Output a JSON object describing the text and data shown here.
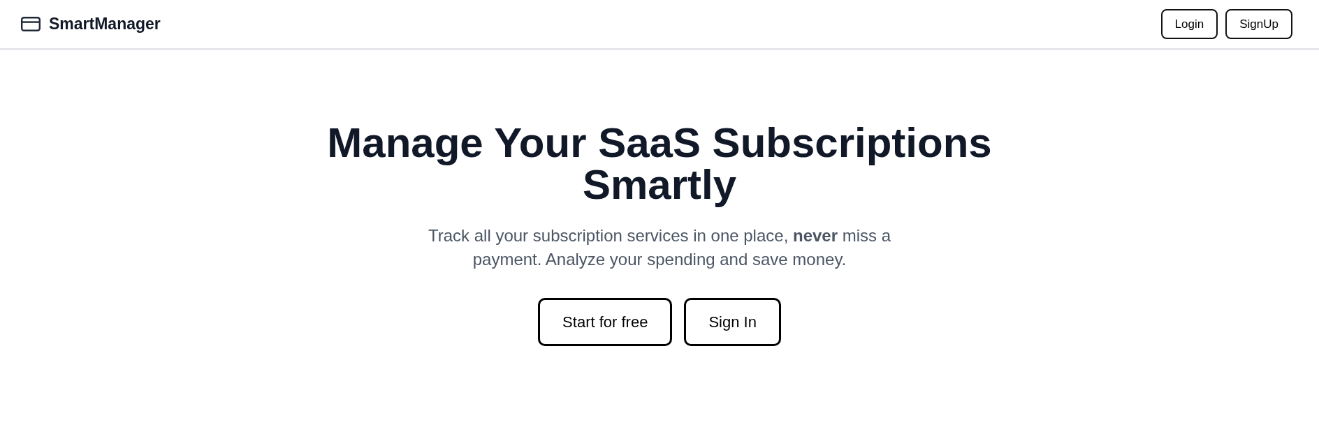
{
  "header": {
    "brand": "SmartManager",
    "buttons": [
      "Login",
      "SignUp"
    ]
  },
  "hero": {
    "title": "Manage Your SaaS Subscriptions Smartly",
    "subtitle": "Track all your subscription services in one place, **never** miss a payment. Analyze your spending and save money.",
    "buttons": [
      "Start for free",
      "Sign In"
    ]
  }
}
